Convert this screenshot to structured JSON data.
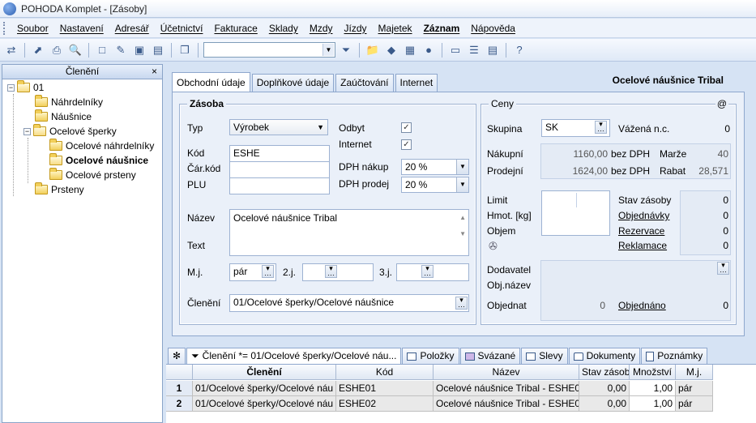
{
  "window": {
    "title": "POHODA Komplet - [Zásoby]"
  },
  "menu": [
    "Soubor",
    "Nastavení",
    "Adresář",
    "Účetnictví",
    "Fakturace",
    "Sklady",
    "Mzdy",
    "Jízdy",
    "Majetek",
    "Záznam",
    "Nápověda"
  ],
  "tree": {
    "header": "Členění",
    "close": "×",
    "nodes": [
      {
        "label": "01",
        "level": 0,
        "expander": "−"
      },
      {
        "label": "Náhrdelníky",
        "level": 1
      },
      {
        "label": "Náušnice",
        "level": 1
      },
      {
        "label": "Ocelové šperky",
        "level": 1,
        "expander": "−"
      },
      {
        "label": "Ocelové náhrdelníky",
        "level": 2
      },
      {
        "label": "Ocelové náušnice",
        "level": 2,
        "selected": true
      },
      {
        "label": "Ocelové prsteny",
        "level": 2
      },
      {
        "label": "Prsteny",
        "level": 1
      }
    ]
  },
  "tabs": [
    "Obchodní údaje",
    "Doplňkové údaje",
    "Zaúčtování",
    "Internet"
  ],
  "record_title": "Ocelové náušnice Tribal",
  "zasoba": {
    "title": "Zásoba",
    "typ_label": "Typ",
    "typ_value": "Výrobek",
    "kod_label": "Kód",
    "kod_value": "ESHE",
    "carkod_label": "Čár.kód",
    "plu_label": "PLU",
    "odbyt_label": "Odbyt",
    "odbyt_check": "✓",
    "internet_label": "Internet",
    "internet_check": "✓",
    "dph_nakup_label": "DPH nákup",
    "dph_nakup_value": "20 %",
    "dph_prodej_label": "DPH prodej",
    "dph_prodej_value": "20 %",
    "nazev_label": "Název",
    "nazev_value": "Ocelové náušnice Tribal",
    "text_label": "Text",
    "mj_label": "M.j.",
    "mj_value": "pár",
    "mj2_label": "2.j.",
    "mj3_label": "3.j.",
    "cleneni_label": "Členění",
    "cleneni_value": "01/Ocelové šperky/Ocelové náušnice"
  },
  "ceny": {
    "title": "Ceny",
    "at": "@",
    "skupina_label": "Skupina",
    "skupina_value": "SK",
    "vazena_label": "Vážená n.c.",
    "vazena_value": "0",
    "nakupni_label": "Nákupní",
    "nakupni_value": "1160,00",
    "nakupni_unit": "bez DPH",
    "marze_label": "Marže",
    "marze_value": "40",
    "prodejni_label": "Prodejní",
    "prodejni_value": "1624,00",
    "prodejni_unit": "bez DPH",
    "rabat_label": "Rabat",
    "rabat_value": "28,571",
    "limit_label": "Limit",
    "hmot_label": "Hmot. [kg]",
    "objem_label": "Objem",
    "stav_label": "Stav zásoby",
    "stav_value": "0",
    "objednavky_label": "Objednávky",
    "objednavky_value": "0",
    "rezervace_label": "Rezervace",
    "rezervace_value": "0",
    "reklamace_label": "Reklamace",
    "reklamace_value": "0",
    "dodavatel_label": "Dodavatel",
    "objnazev_label": "Obj.název",
    "objednat_label": "Objednat",
    "objednat_value": "0",
    "objednano_label": "Objednáno",
    "objednano_value": "0"
  },
  "bottom_tabs": [
    "✻",
    "Členění *= 01/Ocelové šperky/Ocelové náu...",
    "Položky",
    "Svázané",
    "Slevy",
    "Dokumenty",
    "Poznámky"
  ],
  "grid": {
    "headers": [
      "Členění",
      "Kód",
      "Název",
      "Stav zásoby",
      "Množství",
      "M.j."
    ],
    "rows": [
      {
        "num": "1",
        "cleneni": "01/Ocelové šperky/Ocelové náu",
        "kod": "ESHE01",
        "nazev": "Ocelové náušnice Tribal - ESHE0",
        "stav": "0,00",
        "mnozstvi": "1,00",
        "mj": "pár"
      },
      {
        "num": "2",
        "cleneni": "01/Ocelové šperky/Ocelové náu",
        "kod": "ESHE02",
        "nazev": "Ocelové náušnice Tribal - ESHE0",
        "stav": "0,00",
        "mnozstvi": "1,00",
        "mj": "pár"
      }
    ]
  }
}
